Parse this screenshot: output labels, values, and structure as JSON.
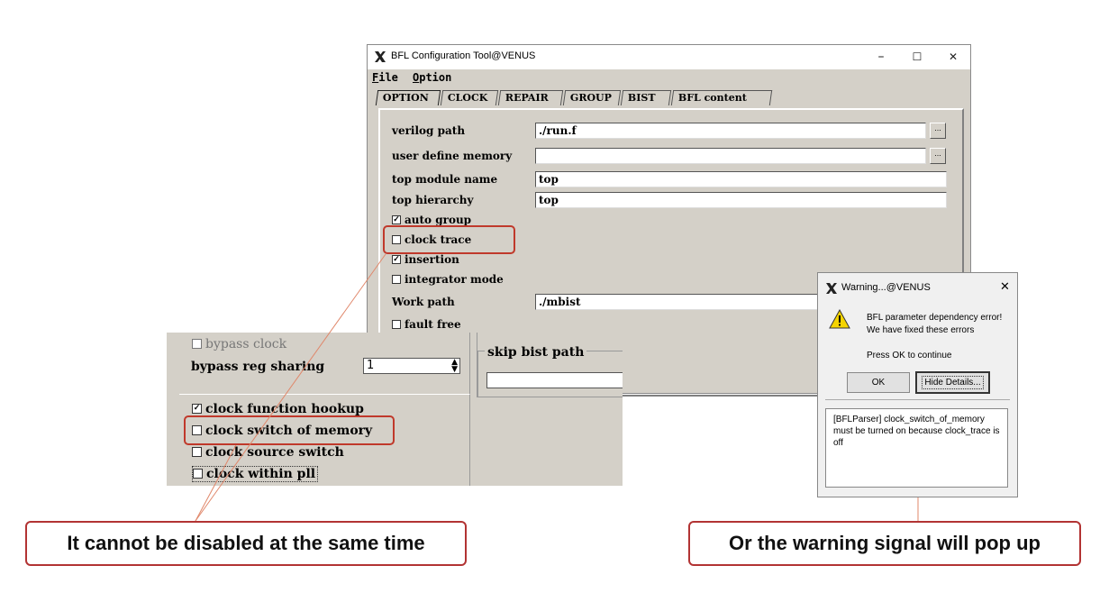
{
  "main_window": {
    "title": "BFL Configuration Tool@VENUS",
    "controls": {
      "minimize": "–",
      "maximize": "☐",
      "close": "✕"
    },
    "menu": [
      {
        "label": "File",
        "mnemonic": "F",
        "rest": "ile"
      },
      {
        "label": "Option",
        "mnemonic": "O",
        "rest": "ption"
      }
    ],
    "tabs": [
      "OPTION",
      "CLOCK",
      "REPAIR",
      "GROUP",
      "BIST",
      "BFL content"
    ],
    "fields": {
      "verilog_path": {
        "label": "verilog path",
        "value": "./run.f",
        "browse": "..."
      },
      "user_define_memory": {
        "label": "user define memory",
        "value": "",
        "browse": "..."
      },
      "top_module_name": {
        "label": "top module name",
        "value": "top"
      },
      "top_hierarchy": {
        "label": "top hierarchy",
        "value": "top"
      },
      "work_path": {
        "label": "Work path",
        "value": "./mbist"
      }
    },
    "checkboxes": {
      "auto_group": {
        "label": "auto group",
        "checked": true
      },
      "clock_trace": {
        "label": "clock trace",
        "checked": false
      },
      "insertion": {
        "label": "insertion",
        "checked": true
      },
      "integrator_mode": {
        "label": "integrator mode",
        "checked": false
      },
      "fault_free": {
        "label": "fault free",
        "checked": false
      }
    },
    "check_glyph": "✓"
  },
  "inset": {
    "bypass_clock": {
      "label": "bypass clock",
      "checked": false
    },
    "bypass_reg_sharing": {
      "label": "bypass reg sharing",
      "value": "1"
    },
    "skip_bist_path": {
      "label": "skip bist path"
    },
    "clock_function_hookup": {
      "label": "clock function hookup",
      "checked": true
    },
    "clock_switch_of_memory": {
      "label": "clock switch of memory",
      "checked": false
    },
    "clock_source_switch": {
      "label": "clock source switch",
      "checked": false
    },
    "clock_within_pll": {
      "label": "clock within pll",
      "checked": false
    }
  },
  "warning_dialog": {
    "title": "Warning...@VENUS",
    "close": "✕",
    "message_line1": "BFL parameter dependency error!",
    "message_line2": "We have fixed these errors",
    "prompt": "Press OK to continue",
    "ok_label": "OK",
    "hide_details_label": "Hide Details...",
    "details": "[BFLParser] clock_switch_of_memory must be turned on because clock_trace is off"
  },
  "callouts": {
    "left": "It cannot be disabled at the same time",
    "right": "Or the warning signal will pop up"
  },
  "colors": {
    "highlight": "#c0392b",
    "window_bg": "#d4d0c8",
    "dialog_bg": "#f0f0f0"
  },
  "icons": {
    "app": "x-logo-icon",
    "warning": "warning-icon"
  }
}
